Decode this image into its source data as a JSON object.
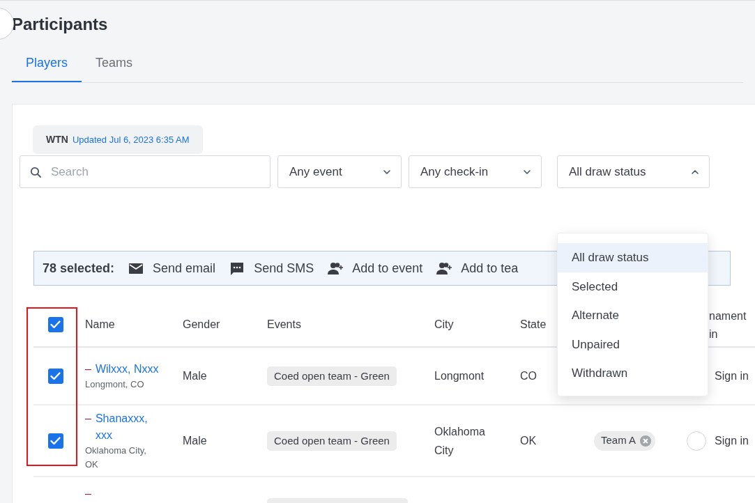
{
  "page": {
    "title": "Participants"
  },
  "tabs": [
    {
      "label": "Players",
      "selected": true
    },
    {
      "label": "Teams",
      "selected": false
    }
  ],
  "rating_badge": {
    "label": "WTN",
    "updated": "Updated Jul 6, 2023 6:35 AM"
  },
  "search": {
    "placeholder": "Search"
  },
  "filters": [
    {
      "value": "Any event",
      "open": false
    },
    {
      "value": "Any check-in",
      "open": false
    },
    {
      "value": "All draw status",
      "open": true
    }
  ],
  "draw_status_menu": [
    {
      "label": "All draw status",
      "selected": true
    },
    {
      "label": "Selected",
      "selected": false
    },
    {
      "label": "Alternate",
      "selected": false
    },
    {
      "label": "Unpaired",
      "selected": false
    },
    {
      "label": "Withdrawn",
      "selected": false
    }
  ],
  "selection_bar": {
    "count": "78 selected:",
    "actions": [
      {
        "kind": "email",
        "label": "Send email"
      },
      {
        "kind": "sms",
        "label": "Send SMS"
      },
      {
        "kind": "add",
        "label": "Add to event"
      },
      {
        "kind": "add",
        "label": "Add to tea"
      }
    ]
  },
  "table": {
    "select_all": {
      "checked": true
    },
    "columns": [
      "Name",
      "Gender",
      "Events",
      "City",
      "State",
      "",
      "nament in"
    ],
    "rows": [
      {
        "checked": true,
        "marker": "–",
        "name": "Wilxxx, Nxxx",
        "location": "Longmont, CO",
        "gender": "Male",
        "event": "Coed open team - Green",
        "city": "Longmont",
        "state": "CO",
        "sign_in": "Sign in"
      },
      {
        "checked": true,
        "marker": "–",
        "name": "Shanaxxx, xxx",
        "location": "Oklahoma City, OK",
        "gender": "Male",
        "event": "Coed open team - Green",
        "city": "Oklahoma City",
        "state": "OK",
        "team": "Team A",
        "radio": {
          "checked": false
        },
        "sign_in": "Sign in"
      },
      {
        "marker": "–"
      }
    ]
  }
}
